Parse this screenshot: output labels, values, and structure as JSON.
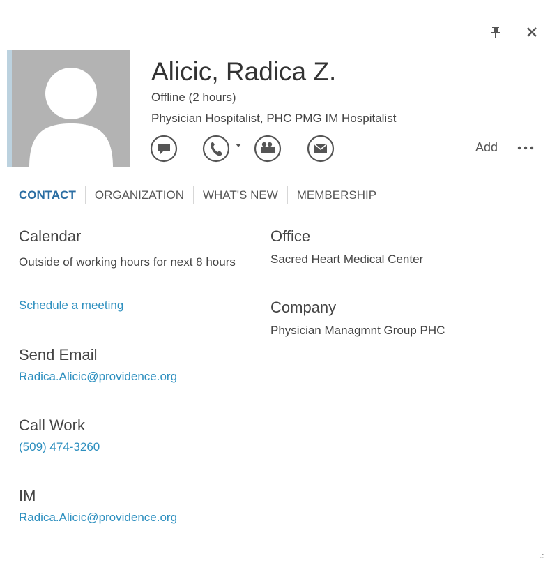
{
  "window": {
    "pin_icon": "pin-icon",
    "close_icon": "close-icon"
  },
  "contact": {
    "name": "Alicic, Radica Z.",
    "status": "Offline (2 hours)",
    "title": "Physician Hospitalist, PHC PMG IM Hospitalist",
    "presence_color": "#bcd2df",
    "photo_placeholder_color": "#b3b3b3"
  },
  "actions": {
    "im_icon": "chat-bubble-icon",
    "call_icon": "phone-icon",
    "video_icon": "video-camera-icon",
    "email_icon": "envelope-icon",
    "add_label": "Add",
    "more_icon": "more-ellipsis-icon"
  },
  "tabs": [
    {
      "label": "CONTACT",
      "active": true
    },
    {
      "label": "ORGANIZATION",
      "active": false
    },
    {
      "label": "WHAT'S NEW",
      "active": false
    },
    {
      "label": "MEMBERSHIP",
      "active": false
    }
  ],
  "details": {
    "calendar_label": "Calendar",
    "calendar_value": "Outside of working hours for next 8 hours",
    "schedule_link": "Schedule a meeting",
    "send_email_label": "Send Email",
    "email": "Radica.Alicic@providence.org",
    "call_work_label": "Call Work",
    "phone": "(509) 474-3260",
    "im_label": "IM",
    "im_address": "Radica.Alicic@providence.org",
    "office_label": "Office",
    "office_value": "Sacred Heart Medical Center",
    "company_label": "Company",
    "company_value": "Physician Managmnt Group PHC"
  },
  "colors": {
    "accent": "#2b6ea3",
    "link": "#2d8fbf",
    "text": "#444444"
  }
}
